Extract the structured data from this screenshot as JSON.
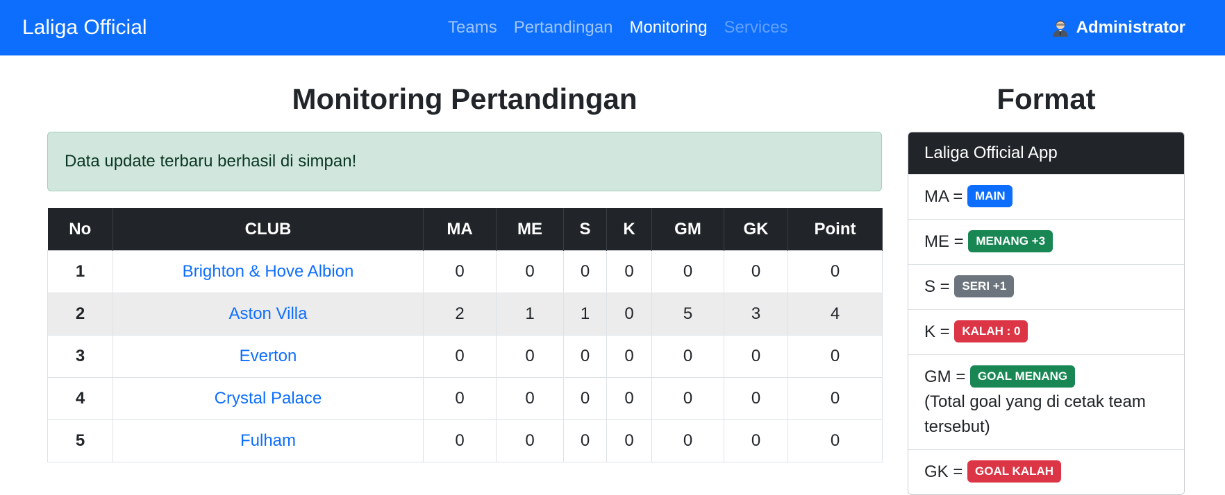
{
  "navbar": {
    "brand": "Laliga Official",
    "links": [
      {
        "label": "Teams",
        "state": "normal"
      },
      {
        "label": "Pertandingan",
        "state": "normal"
      },
      {
        "label": "Monitoring",
        "state": "active"
      },
      {
        "label": "Services",
        "state": "disabled"
      }
    ],
    "user": {
      "icon": "user-avatar-icon",
      "name": "Administrator"
    }
  },
  "main": {
    "title": "Monitoring Pertandingan",
    "alert": "Data update terbaru berhasil di simpan!",
    "columns": [
      "No",
      "CLUB",
      "MA",
      "ME",
      "S",
      "K",
      "GM",
      "GK",
      "Point"
    ],
    "rows": [
      [
        "1",
        "Brighton & Hove Albion",
        "0",
        "0",
        "0",
        "0",
        "0",
        "0",
        "0"
      ],
      [
        "2",
        "Aston Villa",
        "2",
        "1",
        "1",
        "0",
        "5",
        "3",
        "4"
      ],
      [
        "3",
        "Everton",
        "0",
        "0",
        "0",
        "0",
        "0",
        "0",
        "0"
      ],
      [
        "4",
        "Crystal Palace",
        "0",
        "0",
        "0",
        "0",
        "0",
        "0",
        "0"
      ],
      [
        "5",
        "Fulham",
        "0",
        "0",
        "0",
        "0",
        "0",
        "0",
        "0"
      ]
    ]
  },
  "sidebar": {
    "title": "Format",
    "card_header": "Laliga Official App",
    "items": [
      {
        "key": "MA =",
        "badge": "MAIN",
        "color": "#0d6efd",
        "note": ""
      },
      {
        "key": "ME =",
        "badge": "MENANG +3",
        "color": "#198754",
        "note": ""
      },
      {
        "key": "S =",
        "badge": "SERI +1",
        "color": "#6c757d",
        "note": ""
      },
      {
        "key": "K =",
        "badge": "KALAH : 0",
        "color": "#dc3545",
        "note": ""
      },
      {
        "key": "GM =",
        "badge": "GOAL MENANG",
        "color": "#198754",
        "note": "(Total goal yang di cetak team tersebut)"
      },
      {
        "key": "GK =",
        "badge": "GOAL KALAH",
        "color": "#dc3545",
        "note": ""
      }
    ]
  },
  "colors": {
    "primary": "#0d6efd",
    "dark": "#212529",
    "success_bg": "#d1e7dd",
    "stripe": "#ececec"
  }
}
